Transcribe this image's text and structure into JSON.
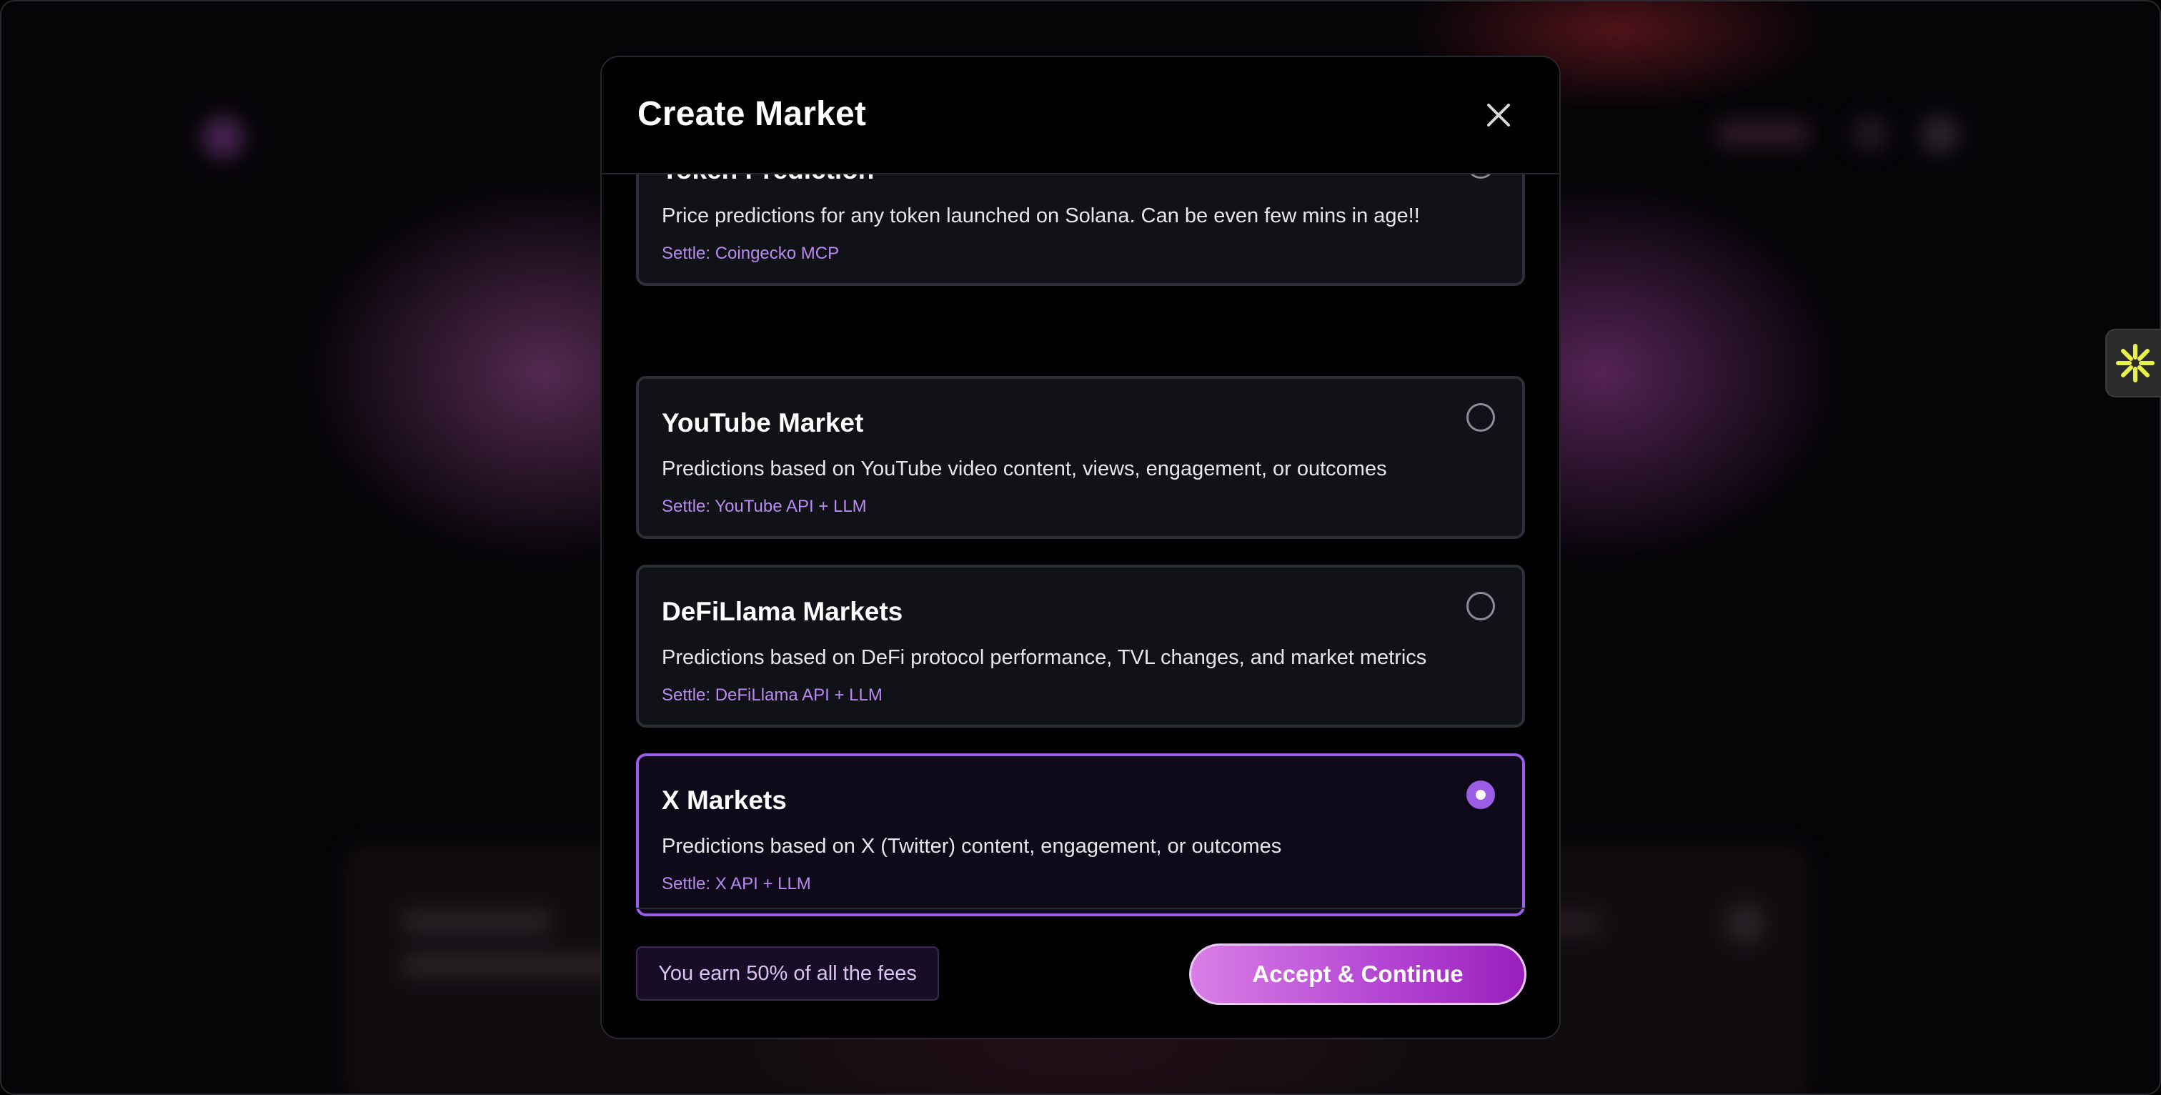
{
  "modal": {
    "title": "Create Market",
    "close_icon": "close-icon"
  },
  "options": [
    {
      "title": "Token Prediction",
      "description": "Price predictions for any token launched on Solana. Can be even few mins in age!!",
      "settle": "Settle: Coingecko MCP",
      "selected": false
    },
    {
      "title": "YouTube Market",
      "description": "Predictions based on YouTube video content, views, engagement, or outcomes",
      "settle": "Settle: YouTube API + LLM",
      "selected": false
    },
    {
      "title": "DeFiLlama Markets",
      "description": "Predictions based on DeFi protocol performance, TVL changes, and market metrics",
      "settle": "Settle: DeFiLlama API + LLM",
      "selected": false
    },
    {
      "title": "X Markets",
      "description": "Predictions based on X (Twitter) content, engagement, or outcomes",
      "settle": "Settle: X API + LLM",
      "selected": true
    }
  ],
  "footer": {
    "fee_note": "You earn 50% of all the fees",
    "accept_label": "Accept & Continue"
  },
  "side_widget": {
    "icon": "asterisk-icon"
  },
  "colors": {
    "accent": "#9b5de5",
    "settle_text": "#b98af0",
    "button_gradient_start": "#d97ee6",
    "button_gradient_end": "#9a1fbd",
    "widget_icon": "#e8f04a"
  }
}
